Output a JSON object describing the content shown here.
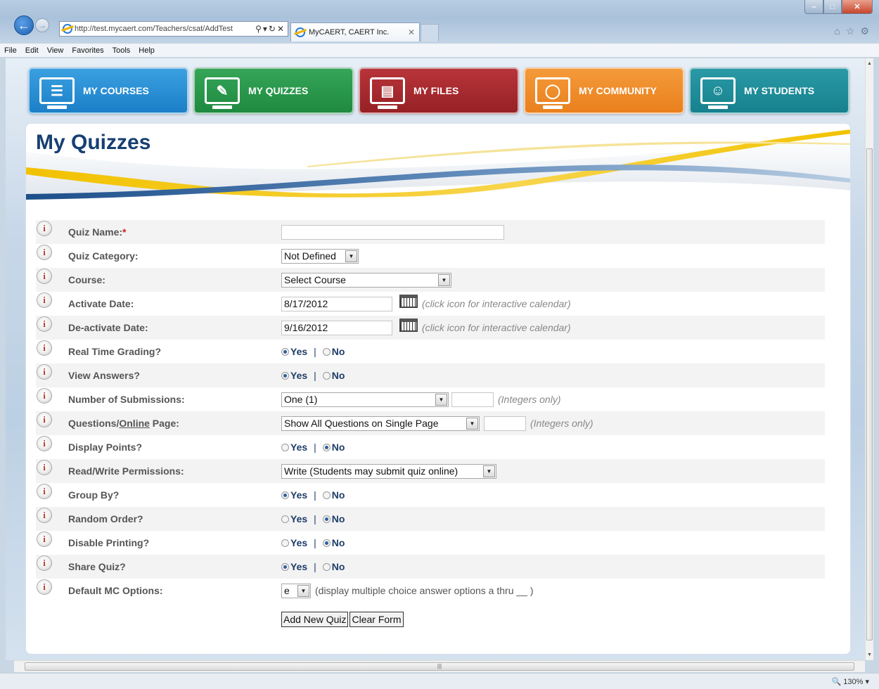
{
  "browser": {
    "address": "http://test.mycaert.com/Teachers/csat/AddTest",
    "tab_title": "MyCAERT, CAERT Inc.",
    "menu": [
      "File",
      "Edit",
      "View",
      "Favorites",
      "Tools",
      "Help"
    ],
    "zoom": "130%"
  },
  "nav": {
    "courses": "MY COURSES",
    "quizzes": "MY QUIZZES",
    "files": "MY FILES",
    "community": "MY COMMUNITY",
    "students": "MY STUDENTS"
  },
  "page": {
    "title": "My Quizzes"
  },
  "form": {
    "quiz_name_label": "Quiz Name:",
    "required_mark": "*",
    "quiz_name_value": "",
    "category_label": "Quiz Category:",
    "category_value": "Not Defined",
    "course_label": "Course:",
    "course_value": "Select Course",
    "activate_label": "Activate Date:",
    "activate_value": "8/17/2012",
    "deactivate_label": "De-activate Date:",
    "deactivate_value": "9/16/2012",
    "calendar_hint": "(click icon for interactive calendar)",
    "realtime_label": "Real Time Grading?",
    "view_answers_label": "View Answers?",
    "submissions_label": "Number of Submissions:",
    "submissions_value": "One (1)",
    "integers_hint": "(Integers only)",
    "qpp_label_a": "Questions/",
    "qpp_label_b": "Online",
    "qpp_label_c": " Page:",
    "qpp_value": "Show All Questions on Single Page",
    "display_points_label": "Display Points?",
    "permissions_label": "Read/Write Permissions:",
    "permissions_value": "Write (Students may submit quiz online)",
    "group_by_label": "Group By?",
    "random_label": "Random Order?",
    "disable_print_label": "Disable Printing?",
    "share_label": "Share Quiz?",
    "mc_label": "Default MC Options:",
    "mc_value": "e",
    "mc_hint": "(display multiple choice answer options a thru __ )",
    "yes": "Yes",
    "no": "No",
    "sep": "|",
    "add_button": "Add New Quiz",
    "clear_button": "Clear Form"
  },
  "radio_state": {
    "real_time_grading": "Yes",
    "view_answers": "Yes",
    "display_points": "No",
    "group_by": "Yes",
    "random_order": "No",
    "disable_printing": "No",
    "share_quiz": "Yes"
  },
  "colors": {
    "courses": "#1c7fc8",
    "quizzes": "#1f8a3f",
    "files": "#962125",
    "community": "#e9801d",
    "students": "#16818d",
    "title": "#173f73"
  }
}
